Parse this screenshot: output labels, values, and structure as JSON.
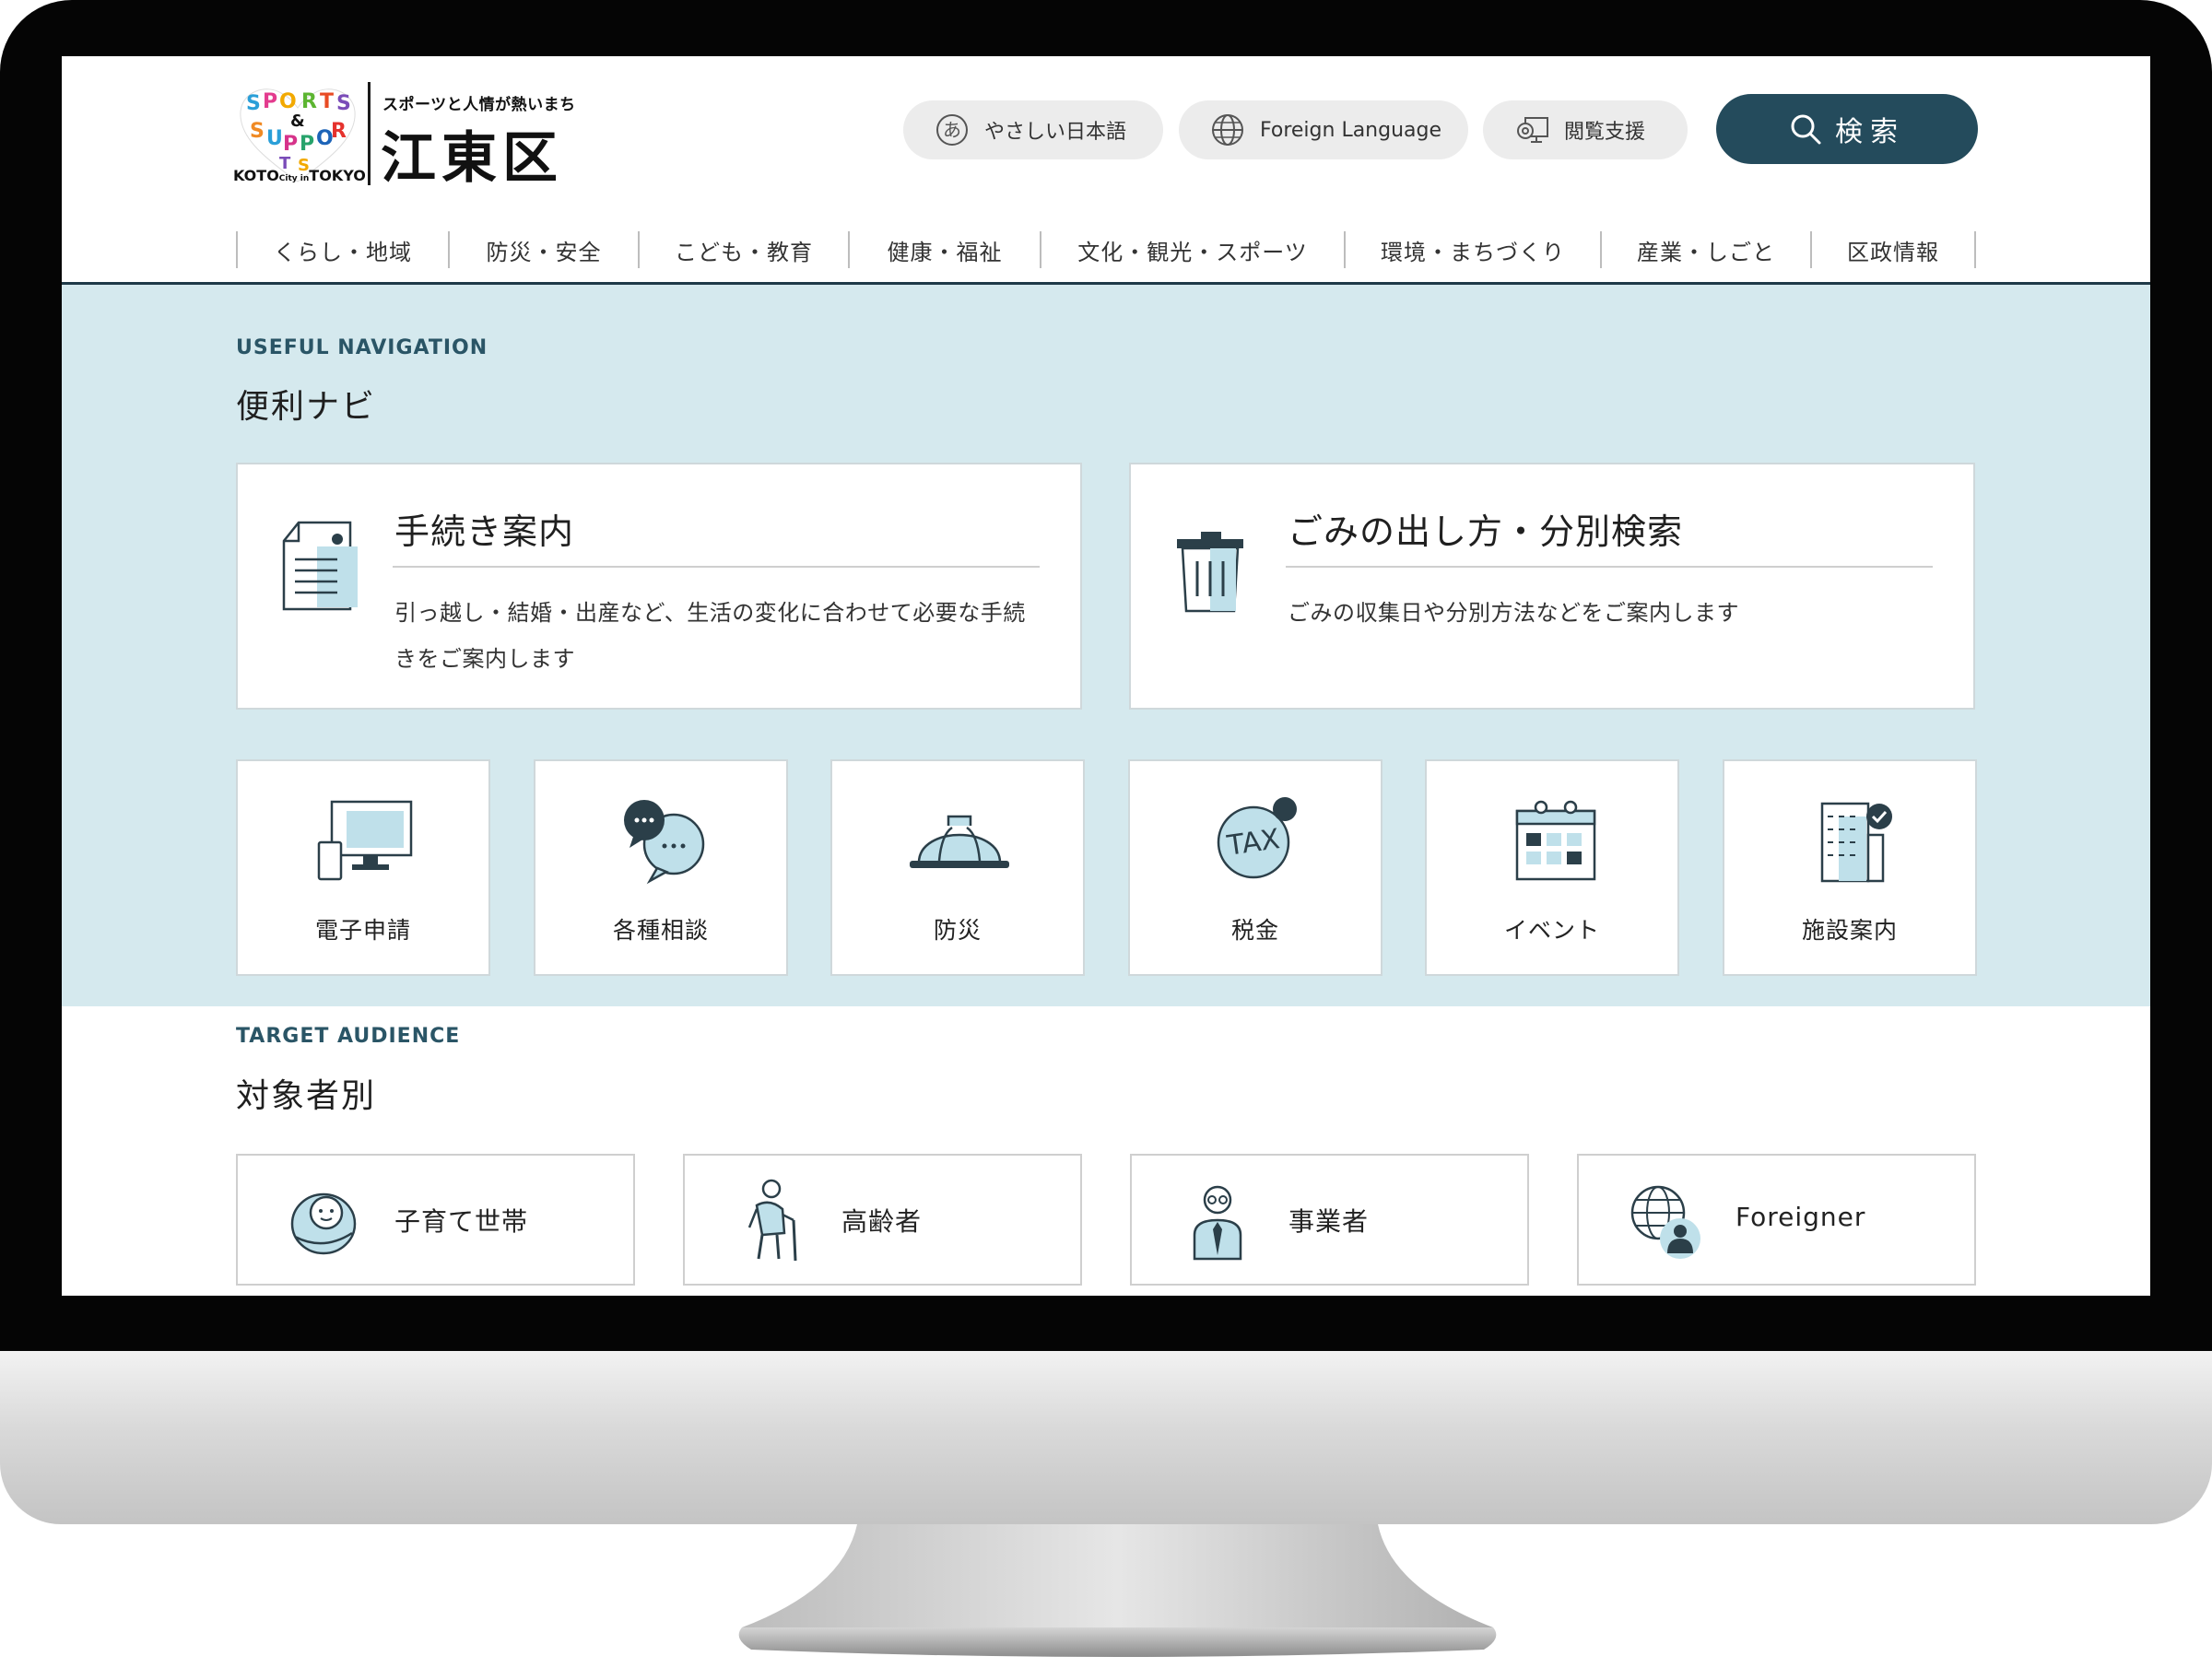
{
  "site": {
    "logo": {
      "tagline": "スポーツと人情が熱いまち",
      "name": "江東区",
      "sub": "KOTO City in TOKYO",
      "mark_text": "SPORTS & SUPPORTS"
    }
  },
  "header": {
    "utility": [
      {
        "label": "やさしい日本語",
        "icon": "hiragana-a-icon"
      },
      {
        "label": "Foreign Language",
        "icon": "globe-icon"
      },
      {
        "label": "閲覧支援",
        "icon": "gear-monitor-icon"
      }
    ],
    "search_label": "検索"
  },
  "nav": {
    "items": [
      "くらし・地域",
      "防災・安全",
      "こども・教育",
      "健康・福祉",
      "文化・観光・スポーツ",
      "環境・まちづくり",
      "産業・しごと",
      "区政情報"
    ]
  },
  "useful": {
    "eyebrow": "USEFUL NAVIGATION",
    "title": "便利ナビ",
    "big_cards": [
      {
        "title": "手続き案内",
        "desc": "引っ越し・結婚・出産など、生活の変化に合わせて必要な手続きをご案内します",
        "icon": "document-icon"
      },
      {
        "title": "ごみの出し方・分別検索",
        "desc": "ごみの収集日や分別方法などをご案内します",
        "icon": "trash-can-icon"
      }
    ],
    "small_cards": [
      {
        "label": "電子申請",
        "icon": "computer-icon"
      },
      {
        "label": "各種相談",
        "icon": "chat-bubbles-icon"
      },
      {
        "label": "防災",
        "icon": "helmet-icon"
      },
      {
        "label": "税金",
        "icon": "tax-icon"
      },
      {
        "label": "イベント",
        "icon": "calendar-icon"
      },
      {
        "label": "施設案内",
        "icon": "building-icon"
      }
    ]
  },
  "target": {
    "eyebrow": "TARGET AUDIENCE",
    "title": "対象者別",
    "cards": [
      {
        "label": "子育て世帯",
        "icon": "baby-icon"
      },
      {
        "label": "高齢者",
        "icon": "elderly-icon"
      },
      {
        "label": "事業者",
        "icon": "businessperson-icon"
      },
      {
        "label": "Foreigner",
        "icon": "globe-person-icon"
      }
    ]
  },
  "colors": {
    "accent": "#244b5c",
    "band": "#d5e9ee",
    "icon_light": "#bfe0ea"
  }
}
